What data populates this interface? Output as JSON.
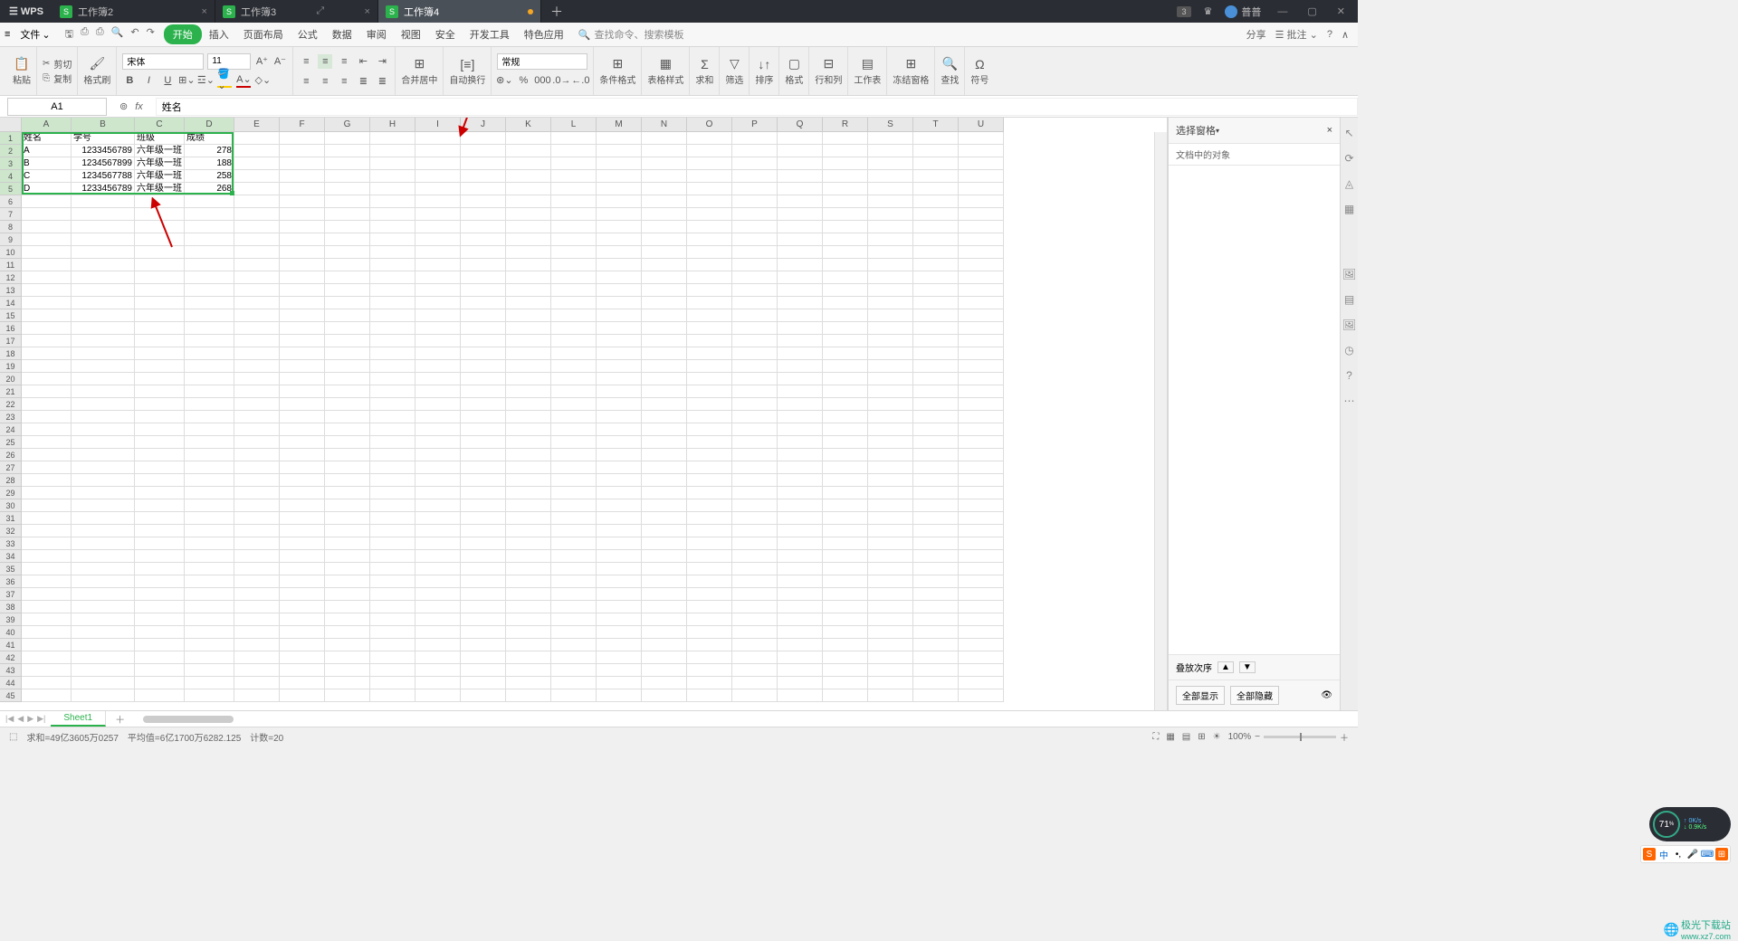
{
  "app": {
    "brand": "WPS"
  },
  "tabs": [
    {
      "label": "工作簿2",
      "active": false
    },
    {
      "label": "工作簿3",
      "active": false
    },
    {
      "label": "工作簿4",
      "active": true
    }
  ],
  "titlebar": {
    "badge": "3",
    "user": "普普"
  },
  "menu": {
    "file": "文件",
    "items": [
      "开始",
      "插入",
      "页面布局",
      "公式",
      "数据",
      "审阅",
      "视图",
      "安全",
      "开发工具",
      "特色应用"
    ],
    "search_placeholder": "查找命令、搜索模板",
    "share": "分享",
    "note": "批注"
  },
  "ribbon": {
    "paste": "粘贴",
    "cut": "剪切",
    "copy": "复制",
    "brush": "格式刷",
    "font": "宋体",
    "size": "11",
    "merge": "合并居中",
    "wrap": "自动换行",
    "numfmt": "常规",
    "cond": "条件格式",
    "tstyle": "表格样式",
    "sum": "求和",
    "filter": "筛选",
    "sort": "排序",
    "format": "格式",
    "rowcol": "行和列",
    "sheet": "工作表",
    "freeze": "冻结窗格",
    "find": "查找",
    "symbol": "符号"
  },
  "namebox": "A1",
  "formula": "姓名",
  "columns": [
    "A",
    "B",
    "C",
    "D",
    "E",
    "F",
    "G",
    "H",
    "I",
    "J",
    "K",
    "L",
    "M",
    "N",
    "O",
    "P",
    "Q",
    "R",
    "S",
    "T",
    "U"
  ],
  "col_widths": {
    "A": 55,
    "B": 70,
    "C": 55,
    "D": 55,
    "other": 50
  },
  "sheet_data": {
    "headers": [
      "姓名",
      "学号",
      "班级",
      "成绩"
    ],
    "rows": [
      [
        "A",
        "1233456789",
        "六年级一班",
        "278"
      ],
      [
        "B",
        "1234567899",
        "六年级一班",
        "188"
      ],
      [
        "C",
        "1234567788",
        "六年级一班",
        "258"
      ],
      [
        "D",
        "1233456789",
        "六年级一班",
        "268"
      ]
    ]
  },
  "pane": {
    "title": "选择窗格",
    "subtitle": "文档中的对象",
    "order": "叠放次序",
    "show_all": "全部显示",
    "hide_all": "全部隐藏"
  },
  "sheettab": "Sheet1",
  "status": {
    "sum": "求和=49亿3605万0257",
    "avg": "平均值=6亿1700万6282.125",
    "count": "计数=20",
    "zoom": "100%"
  },
  "float": {
    "pct": "71",
    "up": "0K/s",
    "down": "0.9K/s"
  },
  "watermark": {
    "name": "极光下载站",
    "url": "www.xz7.com"
  },
  "ime": "中"
}
